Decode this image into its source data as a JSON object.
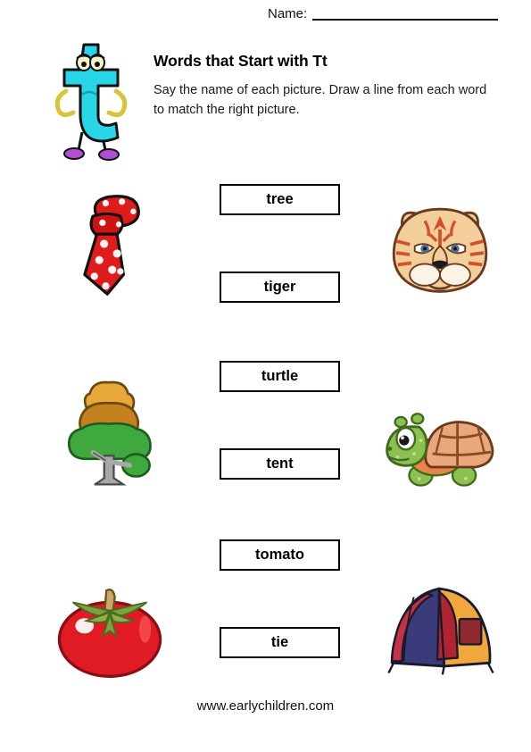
{
  "header": {
    "name_label": "Name:",
    "name_blank": "",
    "title": "Words that Start with Tt",
    "instructions": "Say the name of each picture. Draw a line from each word to match the right picture.",
    "mascot_icon": "letter-t-character-icon"
  },
  "footer": {
    "url": "www.earlychildren.com"
  },
  "colors": {
    "mascot_body": "#29D6E8",
    "mascot_limbs": "#F2E14A",
    "mascot_shoes": "#B24FD0",
    "tie_red": "#E01B1B",
    "tiger_face": "#F2CF9A",
    "tiger_stripe": "#D4502A",
    "tree_green": "#3FA93F",
    "tree_crown": "#C98A28",
    "tree_trunk": "#A8A8A8",
    "turtle_green": "#8CC152",
    "turtle_shell": "#E8A87C",
    "tomato_red": "#E01B24",
    "tomato_stem": "#7FA03C",
    "tent_navy": "#3B3A7A",
    "tent_red": "#B02432",
    "tent_orange": "#F0A83C",
    "box_border": "#000000"
  },
  "rows": [
    {
      "left_picture": "tie-picture",
      "right_picture": "tiger-picture",
      "words": [
        "tree",
        "tiger"
      ]
    },
    {
      "left_picture": "tree-picture",
      "right_picture": "turtle-picture",
      "words": [
        "turtle",
        "tent"
      ]
    },
    {
      "left_picture": "tomato-picture",
      "right_picture": "tent-picture",
      "words": [
        "tomato",
        "tie"
      ]
    }
  ]
}
